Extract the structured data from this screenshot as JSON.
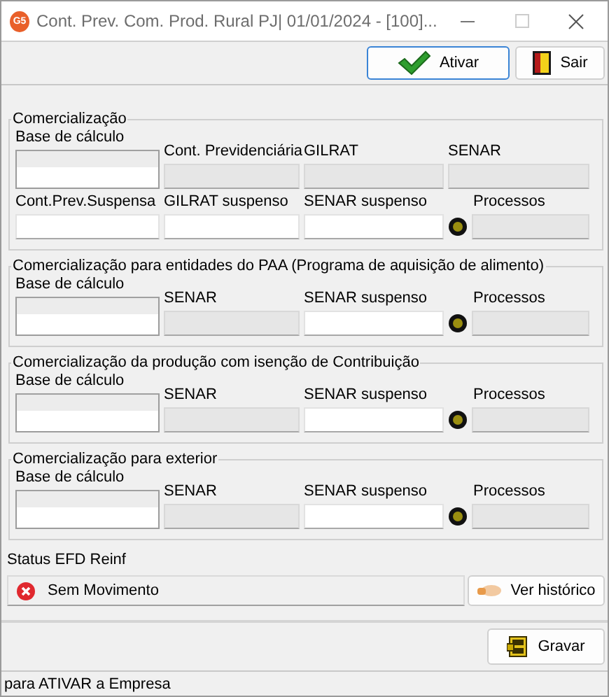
{
  "window": {
    "badge": "G5",
    "title": "Cont. Prev. Com. Prod. Rural PJ|  01/01/2024 - [100]..."
  },
  "toolbar": {
    "buttons": [
      {
        "kind": "activate",
        "label": "Ativar",
        "focused": true
      },
      {
        "kind": "exit",
        "label": "Sair",
        "focused": false
      }
    ]
  },
  "groups": [
    {
      "title": "Comercialização",
      "cells": [
        {
          "kind": "tall",
          "label": "Base de cálculo"
        },
        {
          "kind": "field",
          "label": "Cont. Previdenciária",
          "disabled": true
        },
        {
          "kind": "field",
          "label": "GILRAT",
          "disabled": true
        },
        {
          "kind": "field",
          "label": "SENAR",
          "disabled": true
        },
        {
          "kind": "field",
          "label": "Cont.Prev.Suspensa",
          "disabled": false
        },
        {
          "kind": "field",
          "label": "GILRAT suspenso",
          "disabled": false
        },
        {
          "kind": "field",
          "label": "SENAR suspenso",
          "disabled": false
        },
        {
          "kind": "lookup",
          "label": "Processos",
          "disabled": true
        }
      ]
    },
    {
      "title": "Comercialização para entidades do PAA (Programa de aquisição de alimento)",
      "cells": [
        {
          "kind": "tall",
          "label": "Base de cálculo"
        },
        {
          "kind": "field",
          "label": "SENAR",
          "disabled": true
        },
        {
          "kind": "field",
          "label": "SENAR suspenso",
          "disabled": false
        },
        {
          "kind": "lookup",
          "label": "Processos",
          "disabled": true
        }
      ]
    },
    {
      "title": "Comercialização da produção com isenção de Contribuição",
      "cells": [
        {
          "kind": "tall",
          "label": "Base de cálculo"
        },
        {
          "kind": "field",
          "label": "SENAR",
          "disabled": true
        },
        {
          "kind": "field",
          "label": "SENAR suspenso",
          "disabled": false
        },
        {
          "kind": "lookup",
          "label": "Processos",
          "disabled": true
        }
      ]
    },
    {
      "title": "Comercialização para exterior",
      "cells": [
        {
          "kind": "tall",
          "label": "Base de cálculo"
        },
        {
          "kind": "field",
          "label": "SENAR",
          "disabled": true
        },
        {
          "kind": "field",
          "label": "SENAR suspenso",
          "disabled": false
        },
        {
          "kind": "lookup",
          "label": "Processos",
          "disabled": true
        }
      ]
    }
  ],
  "efd": {
    "label": "Status EFD Reinf",
    "status": "Sem Movimento",
    "history_button": "Ver histórico"
  },
  "footer": {
    "buttons": [
      {
        "kind": "save",
        "label": "Gravar",
        "focused": false
      }
    ]
  },
  "status_bar": "para ATIVAR a Empresa"
}
